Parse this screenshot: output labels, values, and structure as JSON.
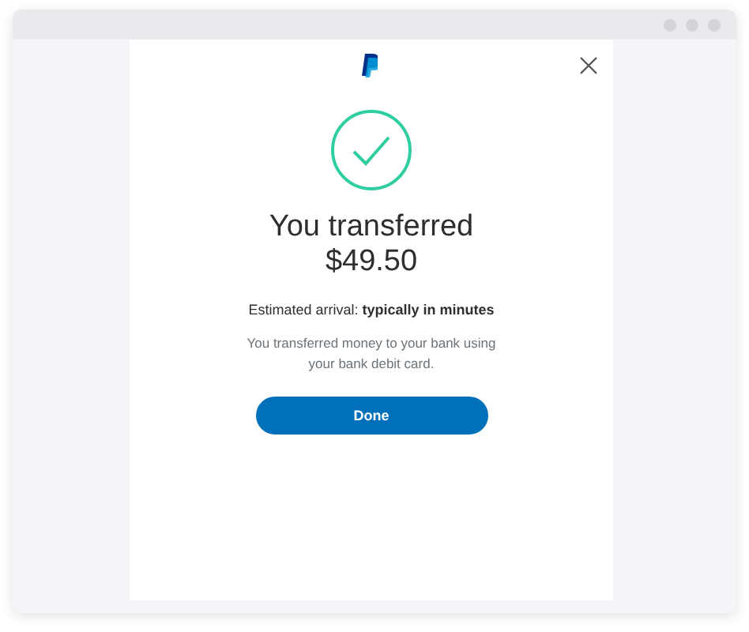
{
  "dialog": {
    "title": "You transferred",
    "amount": "$49.50",
    "arrival": "Estimated arrival: **typically in minutes**",
    "message": "You transferred money to your bank using your bank debit card.",
    "button": "Done"
  }
}
